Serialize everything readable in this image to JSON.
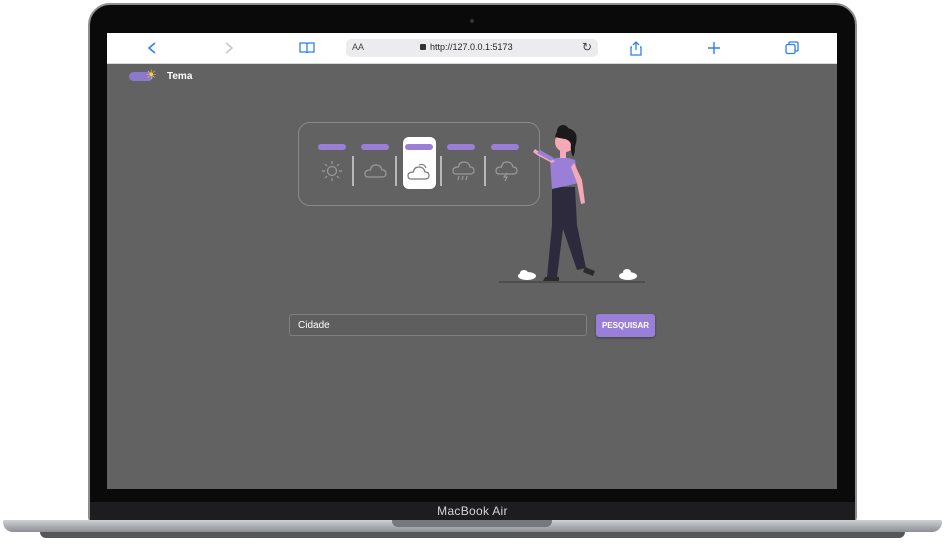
{
  "browser": {
    "text_size_label": "AA",
    "url": "http://127.0.0.1:5173"
  },
  "theme": {
    "label": "Tema"
  },
  "weather": {
    "icons": [
      "sun-icon",
      "cloud-icon",
      "partly-cloudy-icon",
      "rain-icon",
      "storm-icon"
    ],
    "selected_index": 2
  },
  "search": {
    "placeholder": "Cidade",
    "button_label": "PESQUISAR"
  },
  "device": {
    "brand": "MacBook Air"
  },
  "colors": {
    "accent": "#9a7fd8",
    "background": "#626262",
    "browser_accent": "#2f7cf6"
  }
}
